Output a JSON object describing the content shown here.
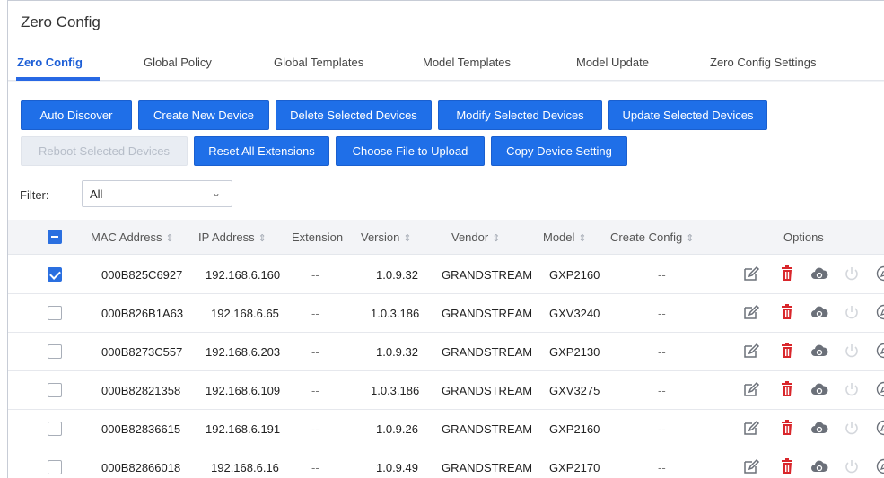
{
  "page": {
    "title": "Zero Config"
  },
  "tabs": [
    {
      "label": "Zero Config",
      "active": true
    },
    {
      "label": "Global Policy",
      "active": false
    },
    {
      "label": "Global Templates",
      "active": false
    },
    {
      "label": "Model Templates",
      "active": false
    },
    {
      "label": "Model Update",
      "active": false
    },
    {
      "label": "Zero Config Settings",
      "active": false
    }
  ],
  "toolbar": {
    "auto_discover": "Auto Discover",
    "create_new_device": "Create New Device",
    "delete_selected": "Delete Selected Devices",
    "modify_selected": "Modify Selected Devices",
    "update_selected": "Update Selected Devices",
    "reboot_selected": "Reboot Selected Devices",
    "reset_all_extensions": "Reset All Extensions",
    "choose_file": "Choose File to Upload",
    "copy_device_setting": "Copy Device Setting"
  },
  "filter": {
    "label": "Filter:",
    "value": "All"
  },
  "table": {
    "columns": [
      "MAC Address",
      "IP Address",
      "Extension",
      "Version",
      "Vendor",
      "Model",
      "Create Config",
      "Options"
    ],
    "rows": [
      {
        "mac": "000B825C6927",
        "ip": "192.168.6.160",
        "extension": "--",
        "version": "1.0.9.32",
        "vendor": "GRANDSTREAM",
        "model": "GXP2160",
        "create_config": "--",
        "checked": true
      },
      {
        "mac": "000B826B1A63",
        "ip": "192.168.6.65",
        "extension": "--",
        "version": "1.0.3.186",
        "vendor": "GRANDSTREAM",
        "model": "GXV3240",
        "create_config": "--",
        "checked": false
      },
      {
        "mac": "000B8273C557",
        "ip": "192.168.6.203",
        "extension": "--",
        "version": "1.0.9.32",
        "vendor": "GRANDSTREAM",
        "model": "GXP2130",
        "create_config": "--",
        "checked": false
      },
      {
        "mac": "000B82821358",
        "ip": "192.168.6.109",
        "extension": "--",
        "version": "1.0.3.186",
        "vendor": "GRANDSTREAM",
        "model": "GXV3275",
        "create_config": "--",
        "checked": false
      },
      {
        "mac": "000B82836615",
        "ip": "192.168.6.191",
        "extension": "--",
        "version": "1.0.9.26",
        "vendor": "GRANDSTREAM",
        "model": "GXP2160",
        "create_config": "--",
        "checked": false
      },
      {
        "mac": "000B82866018",
        "ip": "192.168.6.16",
        "extension": "--",
        "version": "1.0.9.49",
        "vendor": "GRANDSTREAM",
        "model": "GXP2170",
        "create_config": "--",
        "checked": false
      }
    ]
  },
  "colors": {
    "accent": "#2868e4",
    "button": "#1f6fe8",
    "delete_icon": "#d9262b",
    "cloud_icon": "#6b7079",
    "power_icon": "#d4d7dc",
    "edit_icon": "#6b7079"
  },
  "icons": [
    "edit-icon",
    "delete-icon",
    "cloud-icon",
    "power-icon",
    "compass-icon"
  ]
}
